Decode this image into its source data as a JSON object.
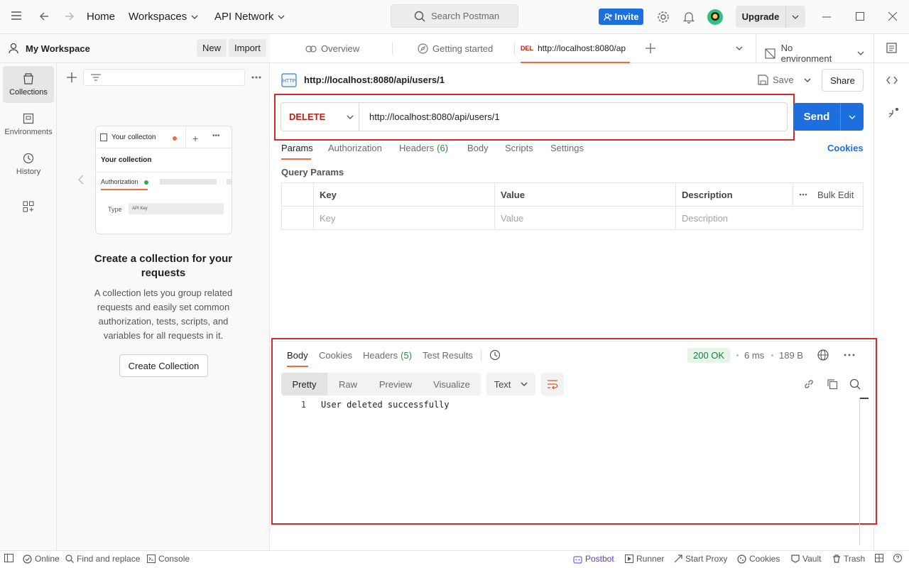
{
  "topbar": {
    "nav": [
      "Home",
      "Workspaces",
      "API Network"
    ],
    "search_placeholder": "Search Postman",
    "invite": "Invite",
    "upgrade": "Upgrade"
  },
  "workspace": {
    "name": "My Workspace",
    "new": "New",
    "import": "Import"
  },
  "rail": [
    {
      "label": "Collections",
      "icon": "collections-icon"
    },
    {
      "label": "Environments",
      "icon": "environments-icon"
    },
    {
      "label": "History",
      "icon": "history-icon"
    }
  ],
  "empty_state": {
    "card_tab": "Your collecton",
    "card_title": "Your collection",
    "card_auth": "Authorization",
    "card_type_label": "Type",
    "card_type_value": "API Key",
    "heading": "Create a collection for your requests",
    "description": "A collection lets you group related requests and easily set common authorization, tests, scripts, and variables for all requests in it.",
    "button": "Create Collection"
  },
  "tabs": {
    "overview": "Overview",
    "getting_started": "Getting started",
    "active_method": "DEL",
    "active_title": "http://localhost:8080/ap",
    "environment": "No environment"
  },
  "request": {
    "title": "http://localhost:8080/api/users/1",
    "save": "Save",
    "share": "Share",
    "method": "DELETE",
    "url": "http://localhost:8080/api/users/1",
    "send": "Send",
    "tabs": [
      "Params",
      "Authorization",
      "Headers",
      "Body",
      "Scripts",
      "Settings"
    ],
    "headers_count": "(6)",
    "cookies": "Cookies",
    "query_params_title": "Query Params",
    "columns": [
      "Key",
      "Value",
      "Description"
    ],
    "bulk_edit": "Bulk Edit",
    "placeholders": [
      "Key",
      "Value",
      "Description"
    ]
  },
  "response": {
    "tabs": [
      "Body",
      "Cookies",
      "Headers",
      "Test Results"
    ],
    "headers_count": "(5)",
    "status": "200 OK",
    "time": "6 ms",
    "size": "189 B",
    "views": [
      "Pretty",
      "Raw",
      "Preview",
      "Visualize"
    ],
    "format": "Text",
    "line_number": "1",
    "body": "User deleted successfully"
  },
  "statusbar": {
    "online": "Online",
    "find": "Find and replace",
    "console": "Console",
    "postbot": "Postbot",
    "runner": "Runner",
    "proxy": "Start Proxy",
    "cookies": "Cookies",
    "vault": "Vault",
    "trash": "Trash"
  },
  "colors": {
    "accent": "#1d6fe0",
    "delete": "#b42318",
    "ok_bg": "#e6f4ea",
    "ok_text": "#1e7d3a",
    "highlight": "#d42a2a"
  }
}
